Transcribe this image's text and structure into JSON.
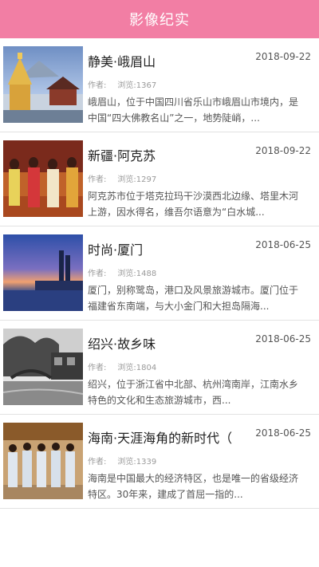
{
  "header": {
    "title": "影像纪实"
  },
  "articles": [
    {
      "title": "静美·峨眉山",
      "date": "2018-09-22",
      "author_label": "作者:",
      "author": "",
      "views_label": "浏览:",
      "views": "1367",
      "desc": "峨眉山，位于中国四川省乐山市峨眉山市境内，是中国“四大佛教名山”之一，地势陡峭，...",
      "image": "emei-mountain-temple-photo"
    },
    {
      "title": "新疆·阿克苏",
      "date": "2018-09-22",
      "author_label": "作者:",
      "author": "",
      "views_label": "浏览:",
      "views": "1297",
      "desc": "阿克苏市位于塔克拉玛干沙漠西北边缘、塔里木河上游，因水得名，维吾尔语意为“白水城...",
      "image": "xinjiang-dancers-photo"
    },
    {
      "title": "时尚·厦门",
      "date": "2018-06-25",
      "author_label": "作者:",
      "author": "",
      "views_label": "浏览:",
      "views": "1488",
      "desc": "厦门，别称鹭岛，港口及风景旅游城市。厦门位于福建省东南端，与大小金门和大担岛隔海...",
      "image": "xiamen-sunset-skyline-photo"
    },
    {
      "title": "绍兴·故乡味",
      "date": "2018-06-25",
      "author_label": "作者:",
      "author": "",
      "views_label": "浏览:",
      "views": "1804",
      "desc": "绍兴，位于浙江省中北部、杭州湾南岸，江南水乡特色的文化和生态旅游城市，西...",
      "image": "shaoxing-water-town-photo"
    },
    {
      "title": "海南·天涯海角的新时代（",
      "date": "2018-06-25",
      "author_label": "作者:",
      "author": "",
      "views_label": "浏览:",
      "views": "1339",
      "desc": "海南是中国最大的经济特区，也是唯一的省级经济特区。30年来，建成了首屈一指的...",
      "image": "hainan-staff-group-photo"
    }
  ]
}
